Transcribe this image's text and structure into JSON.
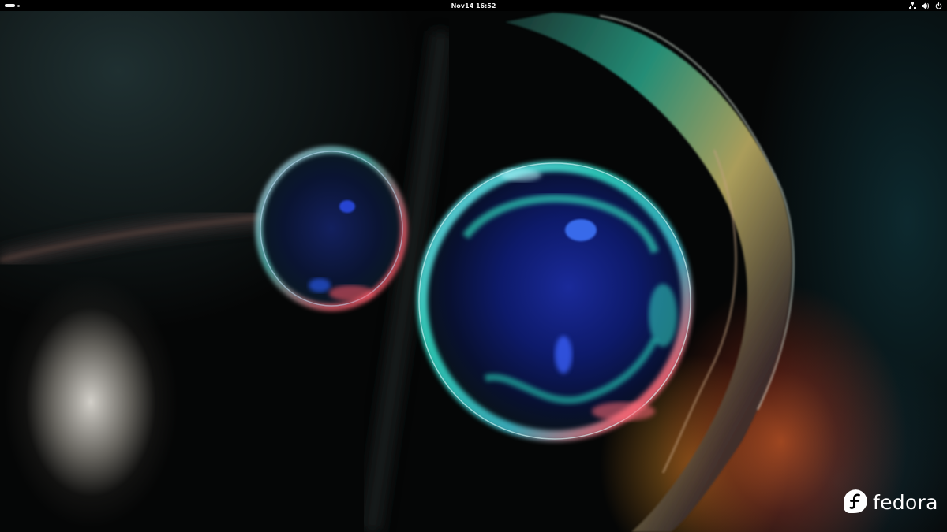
{
  "topbar": {
    "activities_icon": "activities-pill-icon",
    "date": "Nov14",
    "time": "16:52",
    "status_icons": [
      "network-wired-icon",
      "volume-icon",
      "power-icon"
    ]
  },
  "desktop": {
    "wallpaper": "Fedora default wallpaper – abstract glass bubbles on dark background",
    "logo_text": "fedora",
    "logo_icon": "fedora-f-icon"
  },
  "colors": {
    "topbar_bg": "#000000",
    "topbar_text": "#f2f2f2",
    "logo": "#ffffff"
  }
}
